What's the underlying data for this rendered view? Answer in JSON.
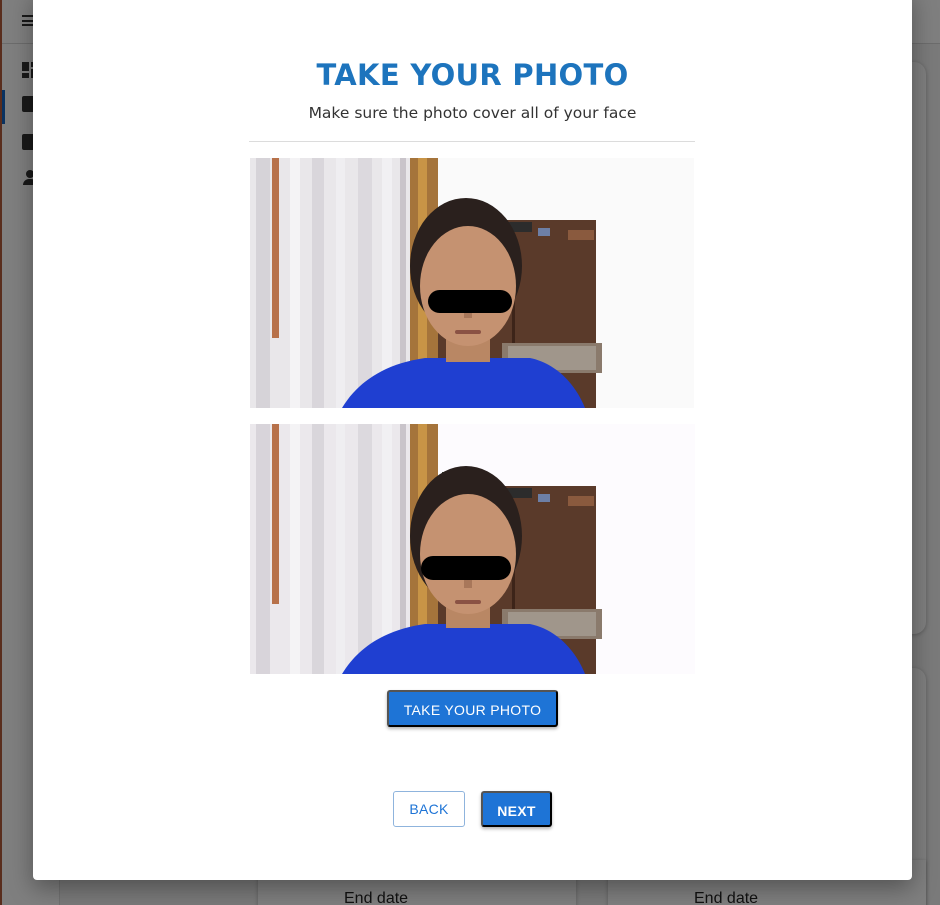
{
  "modal": {
    "title": "TAKE YOUR PHOTO",
    "subtitle": "Make sure the photo cover all of your face",
    "take_photo_label": "TAKE YOUR PHOTO",
    "back_label": "BACK",
    "next_label": "NEXT"
  },
  "background": {
    "card_label_1": "End date",
    "card_label_2": "End date"
  },
  "colors": {
    "accent": "#1e74d6",
    "title": "#1d74bd",
    "shirt": "#1f3fd1"
  },
  "icons": [
    "menu-icon",
    "dashboard-icon",
    "document-icon",
    "chart-icon",
    "person-icon"
  ]
}
